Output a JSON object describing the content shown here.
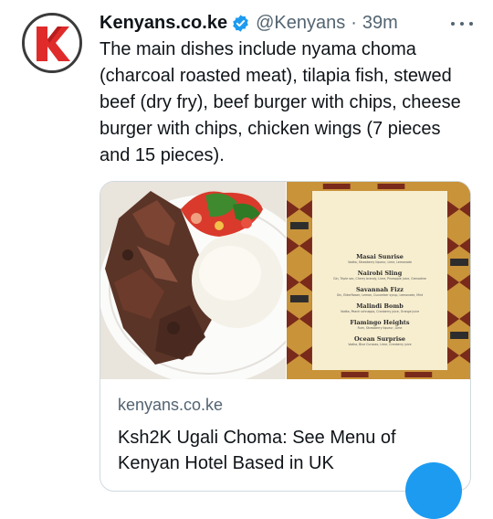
{
  "tweet": {
    "display_name": "Kenyans.co.ke",
    "handle": "@Kenyans",
    "separator": "·",
    "time": "39m",
    "text": "The main dishes include nyama choma (charcoal roasted meat), tilapia fish, stewed beef (dry fry), beef burger with chips, cheese burger with chips, chicken wings (7 pieces and 15 pieces)."
  },
  "card": {
    "domain": "kenyans.co.ke",
    "title": "Ksh2K Ugali Choma: See Menu of Kenyan Hotel Based in UK",
    "menu": [
      {
        "name": "Masai Sunrise",
        "desc": "Vodka, Strawberry liqueur, Lime, Lemonade"
      },
      {
        "name": "Nairobi Sling",
        "desc": "Gin, Triple sec, Cherry brandy, Lime, Pineapple juice, Grenadine"
      },
      {
        "name": "Savannah Fizz",
        "desc": "Gin, Elderflower, Lemon, Cucumber syrup, Lemonade, Mint"
      },
      {
        "name": "Malindi Bomb",
        "desc": "Vodka, Peach schnapps, Cranberry juice, Orange juice"
      },
      {
        "name": "Flamingo Heights",
        "desc": "Rum, Strawberry liqueur, Lime"
      },
      {
        "name": "Ocean Surprise",
        "desc": "Vodka, Blue Curacao, Lime, Cranberry juice"
      }
    ]
  },
  "icons": {
    "avatar": "kenyans-logo-icon",
    "verified": "verified-badge-icon",
    "more": "more-options-icon"
  },
  "colors": {
    "brand_red": "#e02b2b",
    "verified_blue": "#1d9bf0",
    "secondary_text": "#536471"
  }
}
